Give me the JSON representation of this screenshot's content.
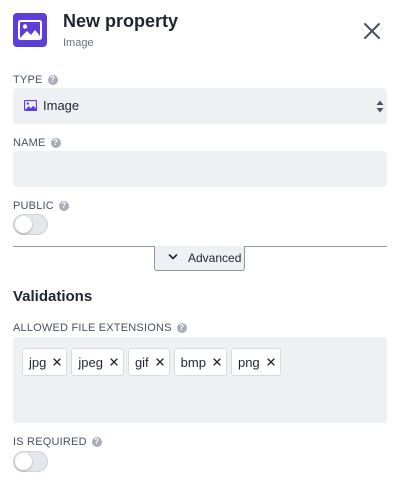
{
  "header": {
    "icon": "image-icon",
    "title": "New property",
    "subtitle": "Image",
    "close_icon": "close-icon"
  },
  "fields": {
    "type": {
      "label": "TYPE",
      "value": "Image",
      "icon": "image-icon"
    },
    "name": {
      "label": "NAME",
      "value": ""
    },
    "public": {
      "label": "PUBLIC",
      "on": false
    }
  },
  "advanced": {
    "label": "Advanced",
    "icon": "chevron-down-icon"
  },
  "validations": {
    "title": "Validations",
    "allowed_extensions": {
      "label": "ALLOWED FILE EXTENSIONS",
      "tags": [
        "jpg",
        "jpeg",
        "gif",
        "bmp",
        "png"
      ]
    },
    "is_required": {
      "label": "IS REQUIRED",
      "on": false
    }
  },
  "colors": {
    "accent": "#5b3fd6",
    "field_bg": "#eef0f3",
    "help_icon": "#a8adb8"
  }
}
